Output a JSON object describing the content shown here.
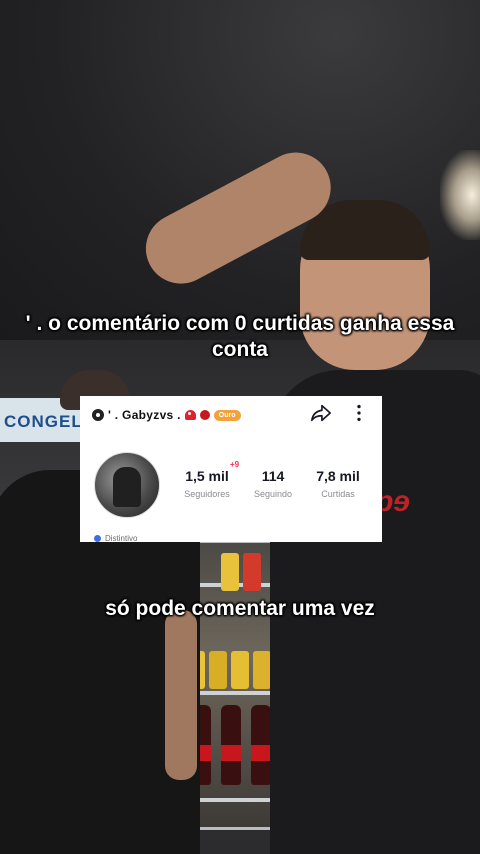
{
  "captions": {
    "top": "' . o comentário com 0 curtidas ganha essa conta",
    "bottom": "só pode comentar uma vez"
  },
  "background": {
    "store_sign": "CONGEL"
  },
  "profile_card": {
    "username": "' . Gabyzvs .",
    "badge_label": "Ouro",
    "icons": [
      "gear-icon",
      "mushroom-icon",
      "ladybug-icon",
      "share-icon",
      "more-icon"
    ],
    "followers_value": "1,5 mil",
    "followers_new": "+9",
    "followers_label": "Seguidores",
    "following_value": "114",
    "following_label": "Seguindo",
    "likes_value": "7,8 mil",
    "likes_label": "Curtidas",
    "distintivo_label": "Distintivo"
  },
  "colors": {
    "caption_text": "#ffffff",
    "card_bg": "#ffffff",
    "badge": "#f2a23a",
    "new_count": "#fe2c55"
  }
}
